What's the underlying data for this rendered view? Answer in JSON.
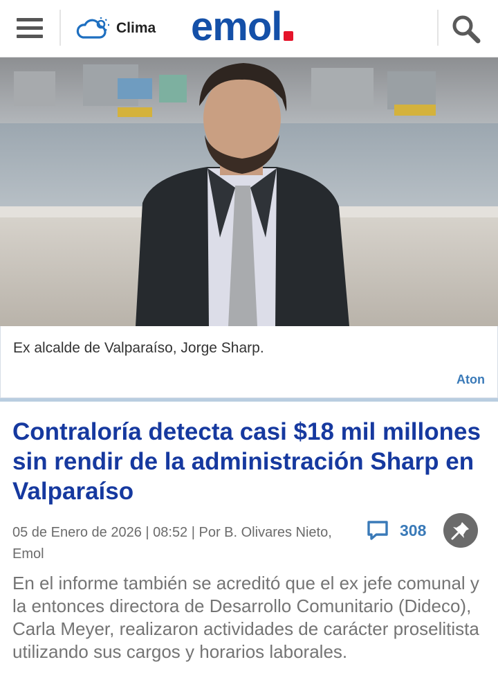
{
  "header": {
    "menu_icon": "hamburger-menu-icon",
    "weather_icon": "cloud-sun-icon",
    "weather_label": "Clima",
    "logo_text": "emol",
    "logo_dot_color": "#e5142a",
    "brand_color": "#1450a8",
    "search_icon": "search-icon"
  },
  "photo": {
    "caption": "Ex alcalde de Valparaíso, Jorge Sharp.",
    "credit": "Aton"
  },
  "article": {
    "headline": "Contraloría detecta casi $18 mil millones sin rendir de la administración Sharp en Valparaíso",
    "meta": "05 de Enero de 2026 | 08:52 | Por B. Olivares Nieto, Emol",
    "comment_icon": "comment-bubble-icon",
    "comment_count": "308",
    "share_icon": "pushpin-icon",
    "lead": "En el informe también se acreditó que el ex jefe comunal y la entonces directora de Desarrollo Comunitario (Dideco), Carla Meyer, realizaron actividades de carácter proselitista utilizando sus cargos y horarios laborales."
  }
}
